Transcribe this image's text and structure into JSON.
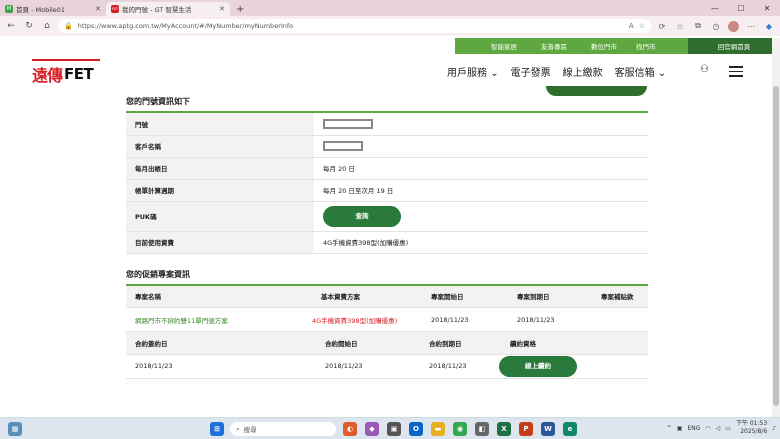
{
  "browser": {
    "tabs": [
      {
        "label": "首頁 - Mobile01",
        "favicon": "M",
        "favcolor": "#3aa34a"
      },
      {
        "label": "我的門號 - GT 智慧生活",
        "favicon": "FET",
        "favcolor": "#d81e25"
      }
    ],
    "new_tab": "+",
    "url": "https://www.aptg.com.tw/MyAccount/#/MyNumber/myNumberInfo"
  },
  "top_links": [
    "智能家居",
    "友善專區",
    "數位門市",
    "找門市"
  ],
  "home_link": "回官網首頁",
  "logo": {
    "cn": "遠傳",
    "en": "FET"
  },
  "main_nav": [
    {
      "label": "用戶服務",
      "caret": true
    },
    {
      "label": "電子發票",
      "caret": false
    },
    {
      "label": "線上繳款",
      "caret": false
    },
    {
      "label": "客服信箱",
      "caret": true
    }
  ],
  "number_info": {
    "title": "您的門號資訊如下",
    "rows": [
      {
        "label": "門號",
        "value": "",
        "redacted": true
      },
      {
        "label": "客戶名稱",
        "value": "",
        "redacted": true
      },
      {
        "label": "每月出帳日",
        "value": "每月 20 日"
      },
      {
        "label": "帳單計算週期",
        "value": "每月 20 日至次月 19 日"
      },
      {
        "label": "PUK碼",
        "value": "查詢",
        "button": true
      },
      {
        "label": "目前使用資費",
        "value": "4G手機資費398型(加購優惠)"
      }
    ]
  },
  "promo": {
    "title": "您的促銷專案資訊",
    "headers": [
      "專案名稱",
      "基本資費方案",
      "專案開始日",
      "專案到期日",
      "專案補貼款"
    ],
    "row": [
      "網路門市不綁約雙11單門號方案",
      "4G手機資費398型(加購優惠)",
      "2018/11/23",
      "2018/11/23",
      ""
    ],
    "headers2": [
      "合約簽約日",
      "合約開始日",
      "合約到期日",
      "續約資格"
    ],
    "row2": [
      "2018/11/23",
      "2018/11/23",
      "2018/11/23"
    ],
    "renew_button": "線上續約"
  },
  "taskbar": {
    "search_placeholder": "搜尋",
    "lang": "ENG",
    "time": "下午 01:53",
    "date": "2025/8/6"
  }
}
